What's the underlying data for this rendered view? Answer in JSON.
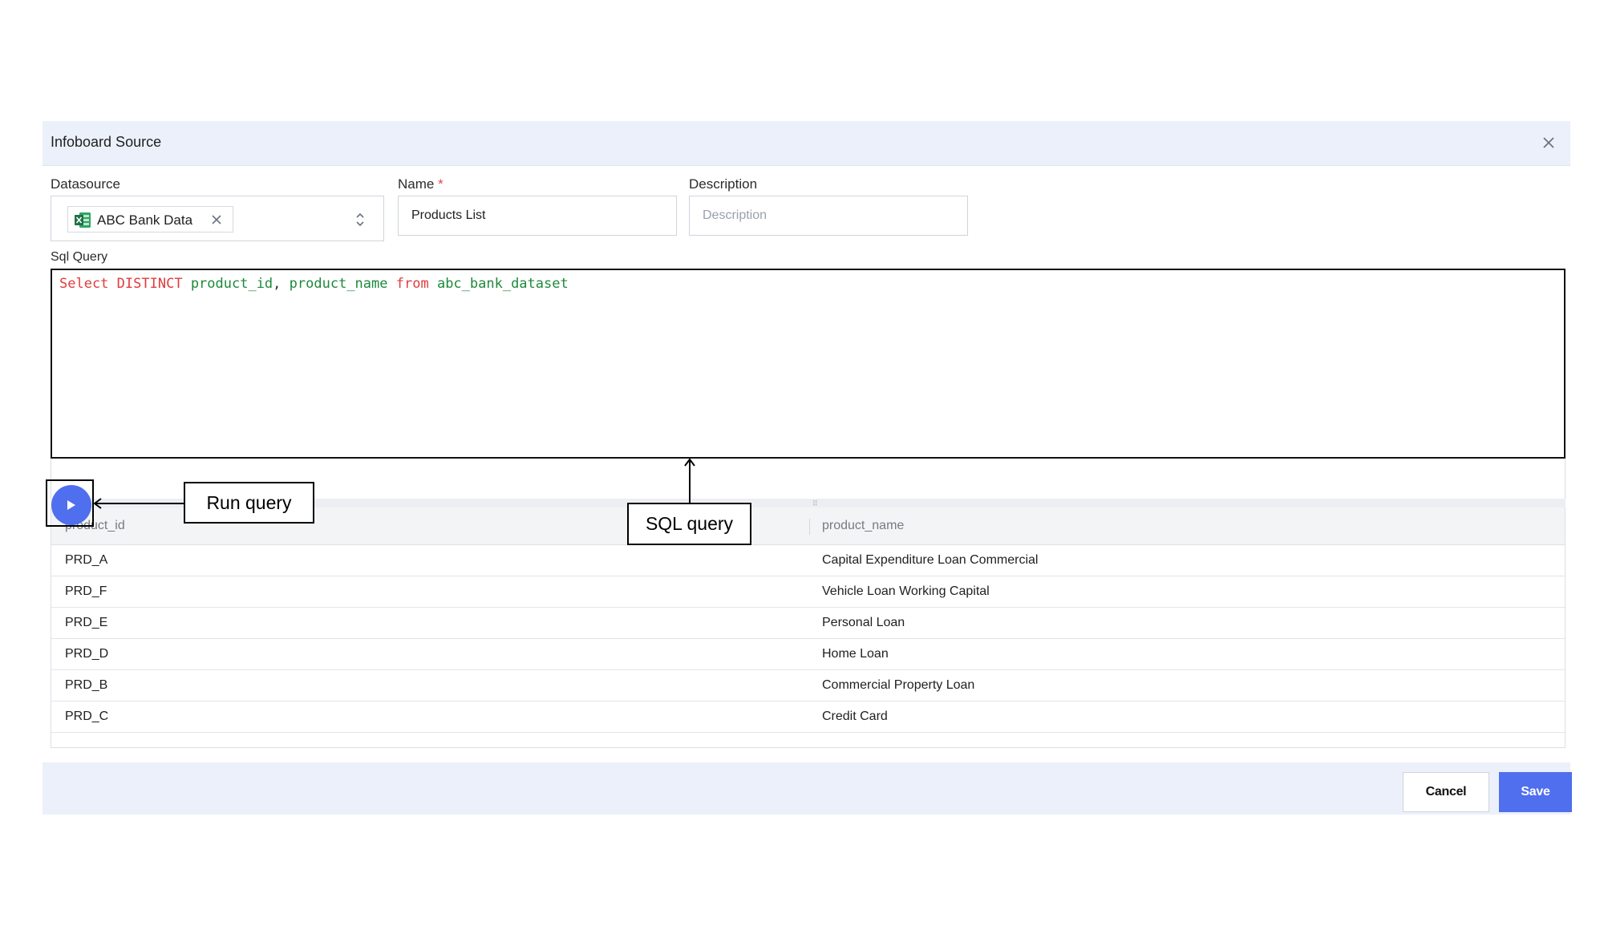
{
  "dialog": {
    "title": "Infoboard Source",
    "close_icon": "close-icon"
  },
  "form": {
    "datasource": {
      "label": "Datasource",
      "selected": "ABC Bank Data",
      "selected_icon": "excel-file-icon"
    },
    "name": {
      "label": "Name",
      "required_mark": "*",
      "value": "Products List"
    },
    "description": {
      "label": "Description",
      "placeholder": "Description",
      "value": ""
    },
    "sql": {
      "label": "Sql Query",
      "tokens": {
        "kw1": "Select",
        "kw2": "DISTINCT",
        "id1": "product_id",
        "comma": ",",
        "id2": "product_name",
        "kw3": "from",
        "id3": "abc_bank_dataset"
      }
    }
  },
  "results": {
    "columns": [
      "product_id",
      "product_name"
    ],
    "rows": [
      [
        "PRD_A",
        "Capital Expenditure Loan Commercial"
      ],
      [
        "PRD_F",
        "Vehicle Loan Working Capital"
      ],
      [
        "PRD_E",
        "Personal Loan"
      ],
      [
        "PRD_D",
        "Home Loan"
      ],
      [
        "PRD_B",
        "Commercial Property Loan"
      ],
      [
        "PRD_C",
        "Credit Card"
      ]
    ]
  },
  "footer": {
    "cancel_label": "Cancel",
    "save_label": "Save"
  },
  "annotations": {
    "run_query": "Run query",
    "sql_query": "SQL query"
  },
  "colors": {
    "accent": "#4f6fee",
    "header_bg": "#ebf0fb",
    "sql_keyword": "#e03c3c",
    "sql_identifier": "#1d8a3a"
  }
}
